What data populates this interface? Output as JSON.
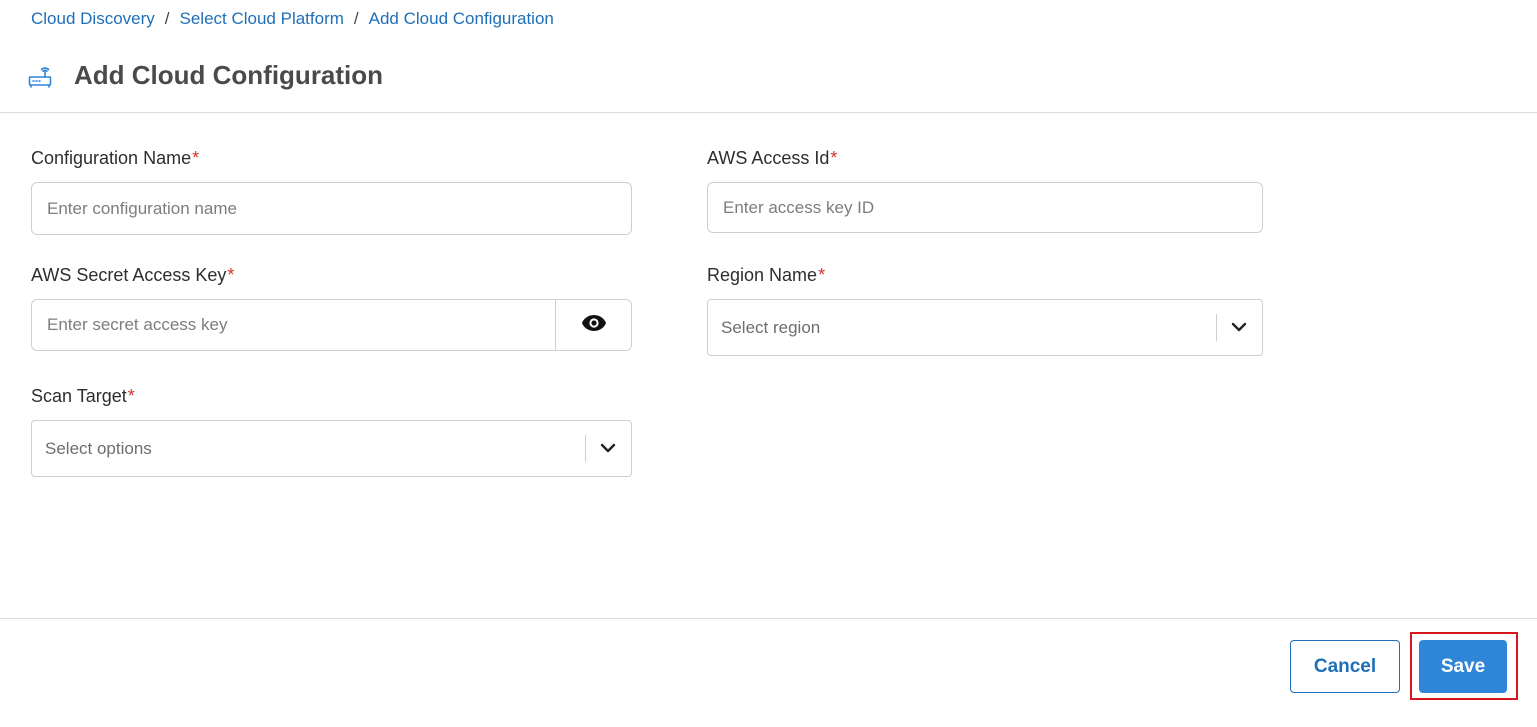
{
  "breadcrumb": {
    "items": [
      "Cloud Discovery",
      "Select Cloud Platform",
      "Add Cloud Configuration"
    ],
    "separator": "/"
  },
  "header": {
    "title": "Add Cloud Configuration",
    "icon": "router-icon"
  },
  "form": {
    "config_name": {
      "label": "Configuration Name",
      "required_mark": "*",
      "placeholder": "Enter configuration name"
    },
    "aws_access_id": {
      "label": "AWS Access Id",
      "required_mark": "*",
      "placeholder": "Enter access key ID"
    },
    "aws_secret_key": {
      "label": "AWS Secret Access Key",
      "required_mark": "*",
      "placeholder": "Enter secret access key",
      "toggle_icon": "eye-icon"
    },
    "region_name": {
      "label": "Region Name",
      "required_mark": "*",
      "selected": "Select region"
    },
    "scan_target": {
      "label": "Scan Target",
      "required_mark": "*",
      "selected": "Select options"
    }
  },
  "footer": {
    "cancel_label": "Cancel",
    "save_label": "Save"
  },
  "colors": {
    "link": "#1f6fb8",
    "primary": "#2f86d8",
    "required": "#d0342c",
    "highlight": "#d6161e"
  }
}
